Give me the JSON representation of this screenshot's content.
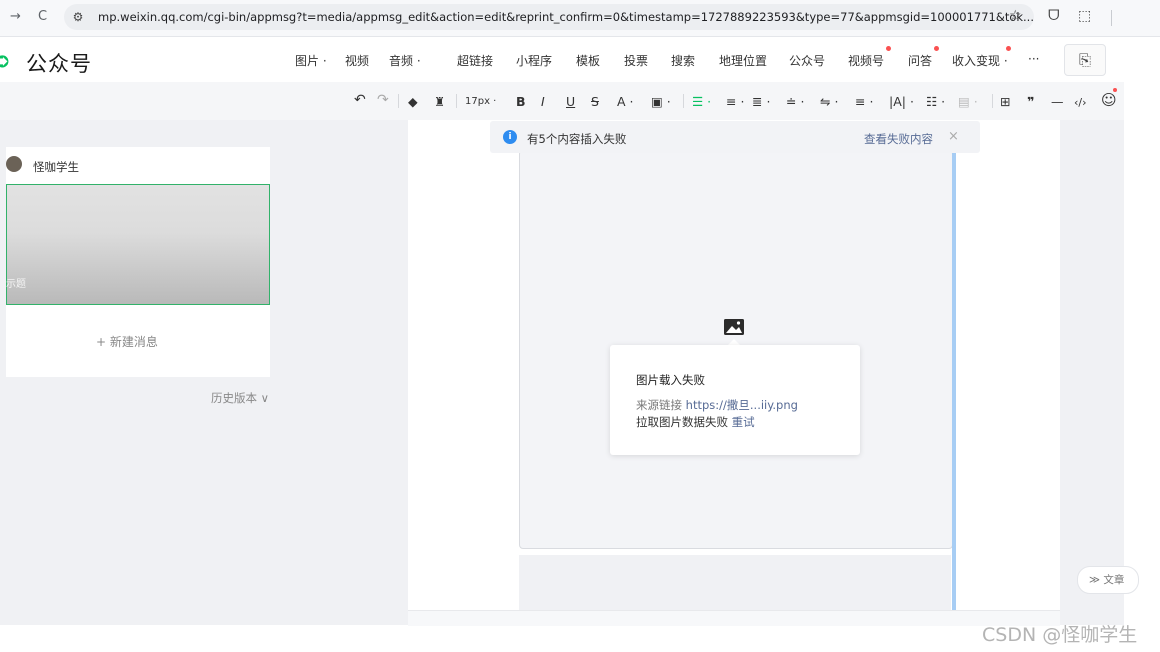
{
  "browser": {
    "back": "→",
    "reload": "C",
    "site_info": "⚙",
    "url": "mp.weixin.qq.com/cgi-bin/appmsg?t=media/appmsg_edit&action=edit&reprint_confirm=0&timestamp=1727889223593&type=77&appmsgid=100001771&tok...",
    "star": "☆",
    "ext1": "ᗜ",
    "ext2": "⬚"
  },
  "header": {
    "logo_text": "公众号",
    "menu": [
      {
        "label": "图片 ·"
      },
      {
        "label": "视频"
      },
      {
        "label": "音频 ·"
      },
      {
        "label": "超链接"
      },
      {
        "label": "小程序"
      },
      {
        "label": "模板"
      },
      {
        "label": "投票"
      },
      {
        "label": "搜索"
      },
      {
        "label": "地理位置"
      },
      {
        "label": "公众号"
      },
      {
        "label": "视频号"
      },
      {
        "label": "问答"
      },
      {
        "label": "收入变现 ·"
      },
      {
        "label": "···"
      }
    ],
    "doc_icon": "⎘"
  },
  "toolbar": {
    "undo": "↶",
    "redo": "↷",
    "eraser": "◆",
    "brush": "♜",
    "font_size": "17px ·",
    "bold": "B",
    "italic": "I",
    "underline": "U",
    "strike": "S",
    "font_color": "A ·",
    "bg_color": "▣ ·",
    "align_left": "☰ ·",
    "align_center": "≡ ·",
    "align_right": "≣ ·",
    "indent": "≐ ·",
    "line_height": "⇋ ·",
    "spacing": "≡ ·",
    "letter_spacing": "|A| ·",
    "list": "☷ ·",
    "list2": "▤ ·",
    "table": "⊞",
    "quote": "❞",
    "hr": "—",
    "code": "‹/›",
    "emoji": "☺"
  },
  "left_panel": {
    "account_name": "怪咖学生",
    "cover_title": "示题",
    "new_message": "+  新建消息",
    "history": "历史版本 ∨"
  },
  "notice": {
    "icon": "i",
    "text": "有5个内容插入失败",
    "link": "查看失败内容",
    "close": "×"
  },
  "popup": {
    "title": "图片载入失败",
    "source_label": "来源链接",
    "source_url": "https://撒旦...iiy.png",
    "fetch_fail": "拉取图片数据失败",
    "retry": "重试"
  },
  "bottom": {
    "article_pill": "≫ 文章",
    "watermark": "CSDN @怪咖学生"
  },
  "colors": {
    "brand_green": "#07c160",
    "info_blue": "#2e8cf0",
    "link_blue": "#576b95",
    "red_dot": "#fa5151",
    "selection_green": "#32b26a"
  }
}
